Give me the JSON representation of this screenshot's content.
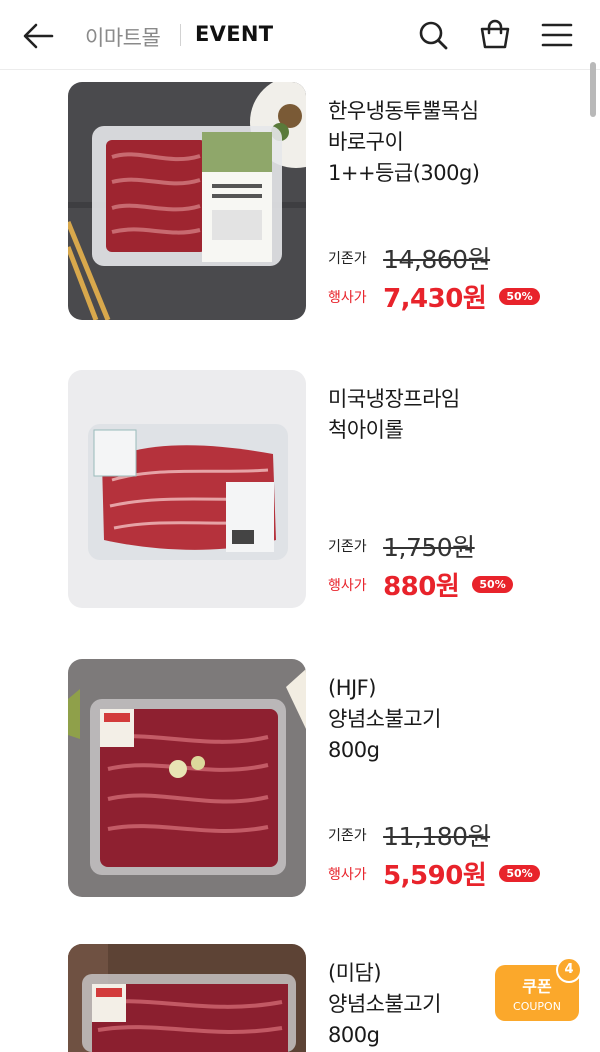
{
  "header": {
    "brand": "이마트몰",
    "title": "EVENT",
    "icons": {
      "back": "arrow-left-icon",
      "search": "search-icon",
      "cart": "shopping-bag-icon",
      "menu": "hamburger-menu-icon"
    }
  },
  "labels": {
    "original": "기존가",
    "sale": "행사가"
  },
  "products": [
    {
      "name": "한우냉동투뿔목심\n바로구이\n1++등급(300g)",
      "original_price": "14,860원",
      "sale_price": "7,430원",
      "discount": "50%"
    },
    {
      "name": "미국냉장프라임\n척아이롤",
      "original_price": "1,750원",
      "sale_price": "880원",
      "discount": "50%"
    },
    {
      "name": "(HJF)\n양념소불고기\n800g",
      "original_price": "11,180원",
      "sale_price": "5,590원",
      "discount": "50%"
    },
    {
      "name": "(미담)\n양념소불고기\n800g"
    }
  ],
  "coupon": {
    "label_ko": "쿠폰",
    "label_en": "COUPON",
    "count": "4"
  },
  "colors": {
    "sale_red": "#e8232b",
    "coupon_orange": "#fba82b"
  }
}
